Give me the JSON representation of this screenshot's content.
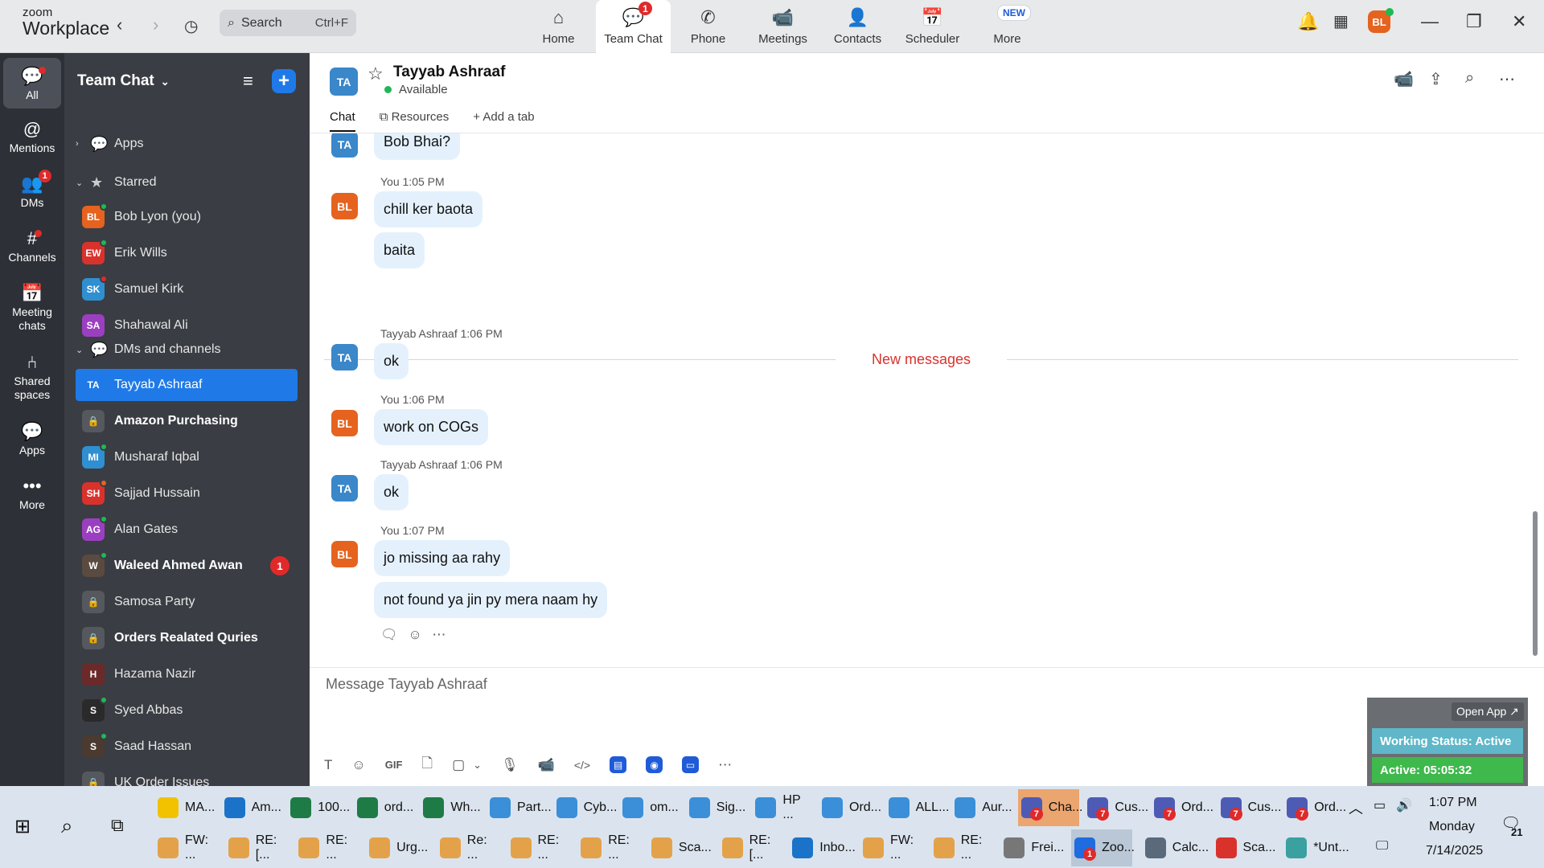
{
  "app": {
    "logo_top": "zoom",
    "logo_bottom": "Workplace"
  },
  "search": {
    "placeholder": "Search",
    "shortcut": "Ctrl+F"
  },
  "nav_tabs": [
    {
      "label": "Home",
      "icon": "⌂"
    },
    {
      "label": "Team Chat",
      "icon": "💬",
      "badge": "1"
    },
    {
      "label": "Phone",
      "icon": "✆"
    },
    {
      "label": "Meetings",
      "icon": "📹"
    },
    {
      "label": "Contacts",
      "icon": "👤"
    },
    {
      "label": "Scheduler",
      "icon": "📅"
    },
    {
      "label": "More",
      "icon": "⋯",
      "new_badge": "NEW"
    }
  ],
  "user_initials": "BL",
  "left_nav": [
    {
      "label": "All",
      "icon": "💬"
    },
    {
      "label": "Mentions",
      "icon": "@"
    },
    {
      "label": "DMs",
      "icon": "👥",
      "badge": "1"
    },
    {
      "label": "Channels",
      "icon": "#"
    },
    {
      "label": "Meeting chats",
      "icon": "📅"
    },
    {
      "label": "Shared spaces",
      "icon": "⑃"
    },
    {
      "label": "Apps",
      "icon": "💬"
    },
    {
      "label": "More",
      "icon": "•••"
    }
  ],
  "sidebar": {
    "title": "Team Chat",
    "sections": {
      "apps": "Apps",
      "starred": "Starred",
      "dms": "DMs and channels"
    },
    "starred": [
      {
        "initials": "BL",
        "name": "Bob Lyon (you)",
        "color": "#e5631f",
        "status": "#1db954"
      },
      {
        "initials": "EW",
        "name": "Erik Wills",
        "color": "#d9322d",
        "status": "#1db954"
      },
      {
        "initials": "SK",
        "name": "Samuel Kirk",
        "color": "#2f8fd1",
        "status": "#e02a2a"
      },
      {
        "initials": "SA",
        "name": "Shahawal Ali",
        "color": "#9b3fc1",
        "status": ""
      }
    ],
    "dms": [
      {
        "initials": "TA",
        "name": "Tayyab Ashraaf",
        "color": "#1f7ae8",
        "status": "",
        "selected": true
      },
      {
        "initials": "🔒",
        "name": "Amazon Purchasing",
        "color": "#55585d",
        "status": "",
        "bold": true
      },
      {
        "initials": "MI",
        "name": "Musharaf Iqbal",
        "color": "#2f8fd1",
        "status": "#1db954"
      },
      {
        "initials": "SH",
        "name": "Sajjad Hussain",
        "color": "#d9322d",
        "status": "#e5631f"
      },
      {
        "initials": "AG",
        "name": "Alan Gates",
        "color": "#9b3fc1",
        "status": "#1db954"
      },
      {
        "initials": "W",
        "name": "Waleed Ahmed Awan",
        "color": "#5a4a40",
        "status": "#1db954",
        "bold": true,
        "unread": "1"
      },
      {
        "initials": "🔒",
        "name": "Samosa Party",
        "color": "#55585d",
        "status": ""
      },
      {
        "initials": "🔒",
        "name": "Orders Realated Quries",
        "color": "#55585d",
        "status": "",
        "bold": true
      },
      {
        "initials": "H",
        "name": "Hazama Nazir",
        "color": "#6b2a2a",
        "status": ""
      },
      {
        "initials": "S",
        "name": "Syed Abbas",
        "color": "#2a2a2a",
        "status": "#1db954"
      },
      {
        "initials": "S",
        "name": "Saad Hassan",
        "color": "#4a3a30",
        "status": "#1db954"
      },
      {
        "initials": "🔒",
        "name": "UK Order Issues",
        "color": "#55585d",
        "status": ""
      }
    ]
  },
  "chat": {
    "initials": "TA",
    "name": "Tayyab Ashraaf",
    "status": "Available",
    "tabs": [
      "Chat",
      "Resources",
      "Add a tab"
    ],
    "new_messages": "New messages",
    "composer_placeholder": "Message Tayyab Ashraaf",
    "messages": [
      {
        "who": "TA",
        "meta": "",
        "text": "Bob Bhai?"
      },
      {
        "who": "BL",
        "meta": "You 1:05 PM",
        "text": "chill ker baota"
      },
      {
        "who": "",
        "meta": "",
        "text": "baita"
      },
      {
        "who": "TA",
        "meta": "Tayyab Ashraaf 1:06 PM",
        "text": "ok"
      },
      {
        "who": "BL",
        "meta": "You 1:06 PM",
        "text": "work on COGs"
      },
      {
        "who": "TA",
        "meta": "Tayyab Ashraaf 1:06 PM",
        "text": "ok"
      },
      {
        "who": "BL",
        "meta": "You 1:07 PM",
        "text": "jo missing aa rahy"
      },
      {
        "who": "",
        "meta": "",
        "text": "not found ya jin py mera naam hy"
      }
    ]
  },
  "composer_tools": [
    "T",
    "☺",
    "GIF",
    "🗋",
    "▢",
    "⌄",
    "🎙",
    "📹",
    "</>"
  ],
  "overlay": {
    "open_app": "Open App ↗",
    "working": "Working Status: Active",
    "active": "Active: 05:05:32"
  },
  "taskbar": {
    "row1": [
      {
        "label": "MA...",
        "color": "#f2c200"
      },
      {
        "label": "Am...",
        "color": "#1a73c9"
      },
      {
        "label": "100...",
        "color": "#1e7b45"
      },
      {
        "label": "ord...",
        "color": "#1e7b45"
      },
      {
        "label": "Wh...",
        "color": "#1e7b45"
      },
      {
        "label": "Part...",
        "color": "#3a8fd8"
      },
      {
        "label": "Cyb...",
        "color": "#3a8fd8"
      },
      {
        "label": "om...",
        "color": "#3a8fd8"
      },
      {
        "label": "Sig...",
        "color": "#3a8fd8"
      },
      {
        "label": "HP ...",
        "color": "#3a8fd8"
      },
      {
        "label": "Ord...",
        "color": "#3a8fd8"
      },
      {
        "label": "ALL...",
        "color": "#3a8fd8"
      },
      {
        "label": "Aur...",
        "color": "#3a8fd8"
      },
      {
        "label": "Cha...",
        "color": "#4e5bb5"
      },
      {
        "label": "Cus...",
        "color": "#4e5bb5"
      },
      {
        "label": "Ord...",
        "color": "#4e5bb5"
      },
      {
        "label": "Cus...",
        "color": "#4e5bb5"
      },
      {
        "label": "Ord...",
        "color": "#4e5bb5"
      }
    ],
    "row2": [
      {
        "label": "FW: ...",
        "color": "#e3a24a"
      },
      {
        "label": "RE: [...",
        "color": "#e3a24a"
      },
      {
        "label": "RE: ...",
        "color": "#e3a24a"
      },
      {
        "label": "Urg...",
        "color": "#e3a24a"
      },
      {
        "label": "Re: ...",
        "color": "#e3a24a"
      },
      {
        "label": "RE: ...",
        "color": "#e3a24a"
      },
      {
        "label": "RE: ...",
        "color": "#e3a24a"
      },
      {
        "label": "Sca...",
        "color": "#e3a24a"
      },
      {
        "label": "RE: [...",
        "color": "#e3a24a"
      },
      {
        "label": "Inbo...",
        "color": "#1a73c9"
      },
      {
        "label": "FW: ...",
        "color": "#e3a24a"
      },
      {
        "label": "RE: ...",
        "color": "#e3a24a"
      },
      {
        "label": "Frei...",
        "color": "#777"
      },
      {
        "label": "Zoo...",
        "color": "#1f6be0"
      },
      {
        "label": "Calc...",
        "color": "#5a6a7a"
      },
      {
        "label": "Sca...",
        "color": "#d9322d"
      },
      {
        "label": "*Unt...",
        "color": "#3aa0a0"
      }
    ],
    "time": "1:07 PM",
    "day": "Monday",
    "date": "7/14/2025",
    "notif": "21"
  }
}
